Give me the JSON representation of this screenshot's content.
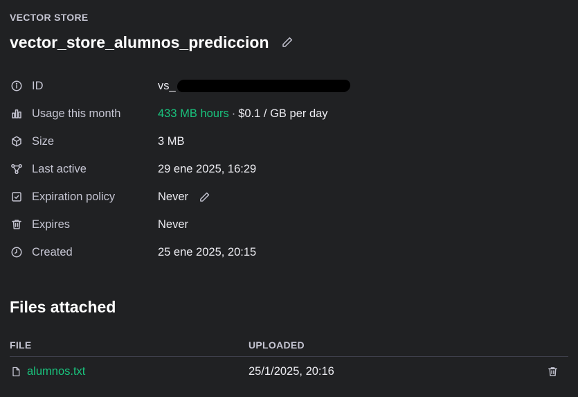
{
  "header": {
    "section_label": "VECTOR STORE",
    "title": "vector_store_alumnos_prediccion"
  },
  "properties": [
    {
      "icon": "info-icon",
      "label": "ID",
      "value": "vs_"
    },
    {
      "icon": "bar-chart-icon",
      "label": "Usage this month",
      "usage": "433 MB hours",
      "separator": "·",
      "rate": "$0.1 / GB per day"
    },
    {
      "icon": "cube-icon",
      "label": "Size",
      "value": "3 MB"
    },
    {
      "icon": "nodes-icon",
      "label": "Last active",
      "value": "29 ene 2025, 16:29"
    },
    {
      "icon": "calendar-check-icon",
      "label": "Expiration policy",
      "value": "Never"
    },
    {
      "icon": "trash-icon",
      "label": "Expires",
      "value": "Never"
    },
    {
      "icon": "clock-icon",
      "label": "Created",
      "value": "25 ene 2025, 20:15"
    }
  ],
  "files": {
    "title": "Files attached",
    "columns": [
      "FILE",
      "UPLOADED"
    ],
    "rows": [
      {
        "name": "alumnos.txt",
        "uploaded": "25/1/2025, 20:16"
      }
    ]
  },
  "colors": {
    "background": "#202123",
    "accent_green": "#19c37d",
    "text": "#ececf1",
    "muted": "#c5c5d2"
  }
}
